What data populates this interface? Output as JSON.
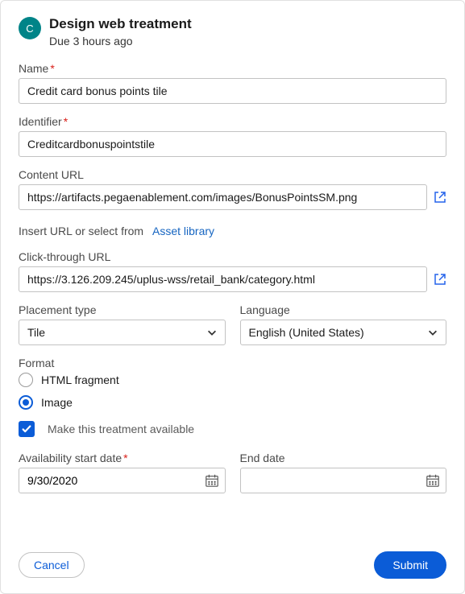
{
  "header": {
    "avatar_initial": "C",
    "title": "Design web treatment",
    "subtitle": "Due 3 hours ago"
  },
  "fields": {
    "name": {
      "label": "Name",
      "required": true,
      "value": "Credit card bonus points tile"
    },
    "identifier": {
      "label": "Identifier",
      "required": true,
      "value": "Creditcardbonuspointstile"
    },
    "content_url": {
      "label": "Content URL",
      "value": "https://artifacts.pegaenablement.com/images/BonusPointsSM.png"
    },
    "hint_prefix": "Insert URL or select from",
    "hint_link": "Asset library",
    "click_url": {
      "label": "Click-through URL",
      "value": "https://3.126.209.245/uplus-wss/retail_bank/category.html"
    },
    "placement": {
      "label": "Placement type",
      "value": "Tile"
    },
    "language": {
      "label": "Language",
      "value": "English (United States)"
    },
    "format": {
      "label": "Format",
      "options": {
        "html": "HTML fragment",
        "image": "Image"
      },
      "selected": "image"
    },
    "available": {
      "label": "Make this treatment available",
      "checked": true
    },
    "start_date": {
      "label": "Availability start date",
      "required": true,
      "value": "9/30/2020"
    },
    "end_date": {
      "label": "End date",
      "value": ""
    }
  },
  "buttons": {
    "cancel": "Cancel",
    "submit": "Submit"
  }
}
